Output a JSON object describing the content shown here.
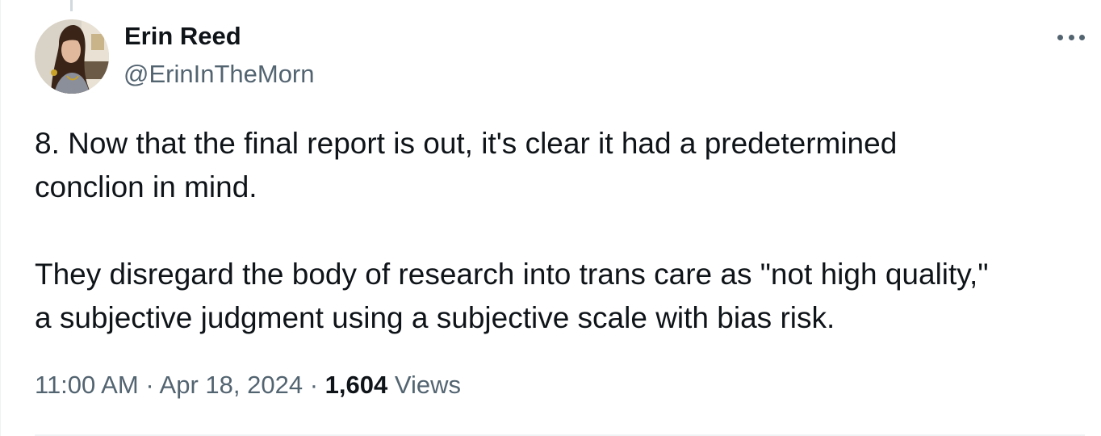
{
  "author": {
    "name": "Erin Reed",
    "handle": "@ErinInTheMorn"
  },
  "tweet": {
    "lines_paragraph_1": [
      "8. Now that the final report is out, it's clear it had a predetermined",
      "conclion in mind."
    ],
    "lines_paragraph_2": [
      "They disregard the body of research into trans care as \"not high quality,\"",
      "a subjective judgment using a subjective scale with bias risk."
    ]
  },
  "meta": {
    "time": "11:00 AM",
    "separator": "·",
    "date": "Apr 18, 2024",
    "views_count": "1,604",
    "views_label": "Views"
  },
  "icons": {
    "more": "more-horizontal-icon",
    "avatar": "profile-photo"
  },
  "colors": {
    "text_primary": "#0f1419",
    "text_secondary": "#536471",
    "divider": "#eff3f4"
  }
}
